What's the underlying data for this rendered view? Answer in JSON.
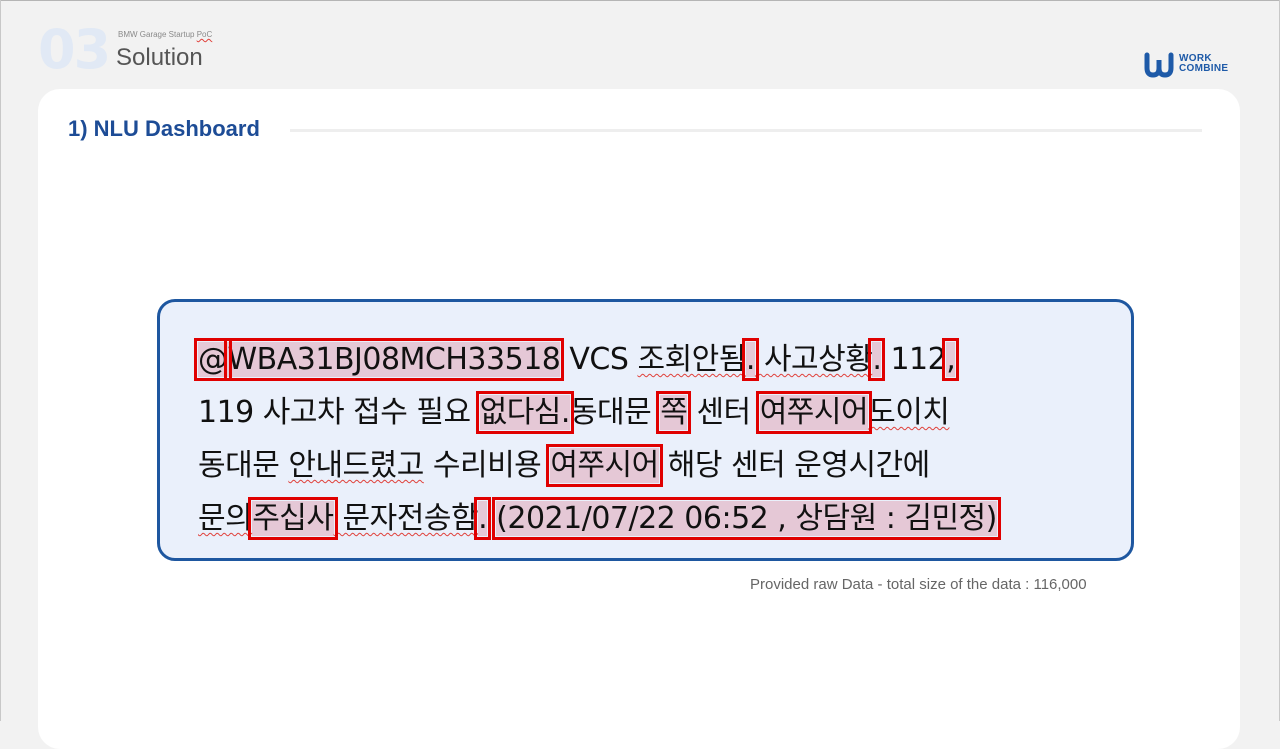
{
  "header": {
    "section_number": "03",
    "subtitle_prefix": "BMW Garage Startup ",
    "subtitle_poc": "PoC",
    "title": "Solution"
  },
  "logo": {
    "line1": "WORK",
    "line2": "COMBINE",
    "icon": "works-combine-logo-icon",
    "color": "#1e5aa8"
  },
  "card": {
    "heading": "1) NLU Dashboard",
    "caption": "Provided raw Data - total size of the data : 116,000"
  },
  "raw_text": {
    "line1": {
      "hl_at": "@",
      "hl_vin": "WBA31BJ08MCH33518",
      "t1": " VCS ",
      "t2": "조회안됨",
      "hl_dot1": ".",
      "t3": " 사고상황",
      "hl_dot2": ".",
      "t4": " 112",
      "hl_comma": ","
    },
    "line2": {
      "t1": "119 사고차 접수 필요 ",
      "hl_w1": "없다심.",
      "t2": "동대문 ",
      "hl_w2": "쪽",
      "t3": " 센터 ",
      "hl_w3": "여쭈시어",
      "t4": "도이치"
    },
    "line3": {
      "t1": "동대문 ",
      "t2": "안내드렸고",
      "t3": " 수리비용 ",
      "hl_w1": "여쭈시어",
      "t4": " 해당 센터 운영시간에"
    },
    "line4": {
      "t1": "문의",
      "hl_w1": "주십사",
      "t2": " 문자전송함",
      "hl_dot": ".",
      "t3": " ",
      "hl_meta": "(2021/07/22 06:52 , 상담원 : 김민정)"
    }
  },
  "colors": {
    "accent": "#1d4c96",
    "box_border": "#1e57a0",
    "box_fill": "#eaf0fb",
    "highlight_border": "#e00000"
  }
}
